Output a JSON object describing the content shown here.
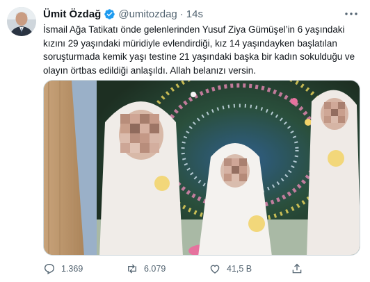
{
  "tweet": {
    "author_name": "Ümit Özdağ",
    "handle": "@umitozdag",
    "separator": "·",
    "time": "14s",
    "text": "İsmail Ağa Tatikatı önde gelenlerinden Yusuf Ziya Gümüşel’in 6 yaşındaki kızını 29 yaşındaki müridiyle evlendirdiği, kız 14 yaşındayken başlatılan soruşturmada kemik yaşı testine 21 yaşındaki başka bir kadın sokulduğu ve olayın örtbas edildiği anlaşıldı. Allah belanızı versin.",
    "media": {
      "description_icon": "photo-with-blurred-faces"
    }
  },
  "actions": {
    "reply_count": "1.369",
    "retweet_count": "6.079",
    "like_count": "41,5 B"
  },
  "icons": {
    "verified": "verified-badge-icon",
    "more": "more-icon",
    "reply": "reply-icon",
    "retweet": "retweet-icon",
    "like": "like-icon",
    "share": "share-icon"
  },
  "colors": {
    "verified": "#1d9bf0",
    "text": "#0f1419",
    "secondary": "#536471",
    "border": "#cfd9de"
  }
}
